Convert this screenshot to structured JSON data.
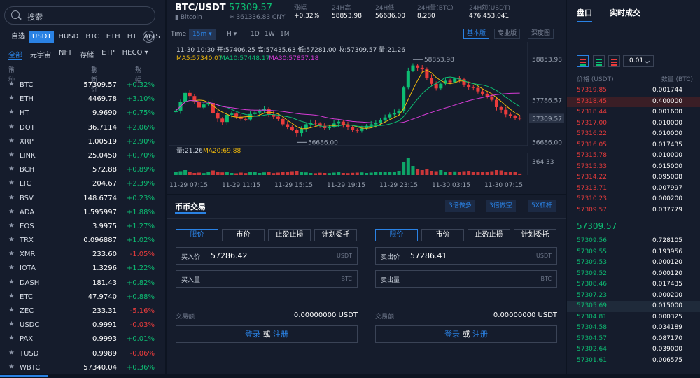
{
  "search": {
    "placeholder": "搜索"
  },
  "market_tabs": [
    "自选",
    "USDT",
    "HUSD",
    "BTC",
    "ETH",
    "HT",
    "ALTS"
  ],
  "market_tab_active": 1,
  "sub_tabs": [
    "全部",
    "元宇宙",
    "NFT",
    "存储",
    "ETP",
    "HECO"
  ],
  "sub_tab_dropdown_icon": "chevron-down-icon",
  "list_header": {
    "coin": "币种",
    "price": "最新价",
    "change": "涨幅"
  },
  "coins": [
    {
      "sym": "BTC",
      "price": "57309.57",
      "chg": "+0.32%",
      "dir": "up"
    },
    {
      "sym": "ETH",
      "price": "4469.78",
      "chg": "+3.10%",
      "dir": "up"
    },
    {
      "sym": "HT",
      "price": "9.9690",
      "chg": "+0.75%",
      "dir": "up"
    },
    {
      "sym": "DOT",
      "price": "36.7114",
      "chg": "+2.06%",
      "dir": "up"
    },
    {
      "sym": "XRP",
      "price": "1.00519",
      "chg": "+2.90%",
      "dir": "up"
    },
    {
      "sym": "LINK",
      "price": "25.0450",
      "chg": "+0.70%",
      "dir": "up"
    },
    {
      "sym": "BCH",
      "price": "572.88",
      "chg": "+0.89%",
      "dir": "up"
    },
    {
      "sym": "LTC",
      "price": "204.67",
      "chg": "+2.39%",
      "dir": "up"
    },
    {
      "sym": "BSV",
      "price": "148.6774",
      "chg": "+0.23%",
      "dir": "up"
    },
    {
      "sym": "ADA",
      "price": "1.595997",
      "chg": "+1.88%",
      "dir": "up"
    },
    {
      "sym": "EOS",
      "price": "3.9975",
      "chg": "+1.27%",
      "dir": "up"
    },
    {
      "sym": "TRX",
      "price": "0.096887",
      "chg": "+1.02%",
      "dir": "up"
    },
    {
      "sym": "XMR",
      "price": "233.60",
      "chg": "-1.05%",
      "dir": "down"
    },
    {
      "sym": "IOTA",
      "price": "1.3296",
      "chg": "+1.22%",
      "dir": "up"
    },
    {
      "sym": "DASH",
      "price": "181.43",
      "chg": "+0.82%",
      "dir": "up"
    },
    {
      "sym": "ETC",
      "price": "47.9740",
      "chg": "+0.88%",
      "dir": "up"
    },
    {
      "sym": "ZEC",
      "price": "233.31",
      "chg": "-5.16%",
      "dir": "down"
    },
    {
      "sym": "USDC",
      "price": "0.9991",
      "chg": "-0.03%",
      "dir": "down"
    },
    {
      "sym": "PAX",
      "price": "0.9993",
      "chg": "+0.01%",
      "dir": "up"
    },
    {
      "sym": "TUSD",
      "price": "0.9989",
      "chg": "-0.06%",
      "dir": "down"
    },
    {
      "sym": "WBTC",
      "price": "57340.04",
      "chg": "+0.36%",
      "dir": "up"
    }
  ],
  "header": {
    "pair": "BTC/USDT",
    "pair_sub": "Bitcoin",
    "last_price": "57309.57",
    "last_cny": "≈ 361336.83 CNY",
    "stats": [
      {
        "label": "涨幅",
        "value": "+0.32%"
      },
      {
        "label": "24H高",
        "value": "58853.98"
      },
      {
        "label": "24H低",
        "value": "56686.00"
      },
      {
        "label": "24H量(BTC)",
        "value": "8,280"
      },
      {
        "label": "24H额(USDT)",
        "value": "476,453,041"
      }
    ]
  },
  "chart_tools": {
    "time": "Time",
    "interval": "15m",
    "h": "H",
    "d1": "1D",
    "w1": "1W",
    "m1": "1M",
    "views": [
      "基本版",
      "专业版",
      "深度图"
    ]
  },
  "chart_data": {
    "type": "candlestick",
    "ohlc_info": "11-30 10:30  开:57406.25 高:57435.63 低:57281.00 收:57309.57 量:21.26",
    "ma_info": [
      {
        "label": "MA5:57340.07",
        "color": "#f0b90b"
      },
      {
        "label": "MA10:57448.17",
        "color": "#0dbd73"
      },
      {
        "label": "MA30:57857.18",
        "color": "#d63bd6"
      }
    ],
    "price_axis": [
      "58853.98",
      "57786.57",
      "57309.57",
      "56686.00"
    ],
    "high_marker": "58853.98",
    "low_marker": "56686.00",
    "volume_info": {
      "vol": "量:21.26",
      "ma20": "MA20:69.88"
    },
    "volume_axis": "364.33",
    "time_axis": [
      "11-29 07:15",
      "11-29 11:15",
      "11-29 15:15",
      "11-29 19:15",
      "11-29 23:15",
      "11-30 03:15",
      "11-30 07:15"
    ],
    "close": [
      57520,
      57740,
      57980,
      57900,
      57760,
      57600,
      57680,
      57720,
      57460,
      57310,
      57220,
      57410,
      57440,
      57360,
      57300,
      57290,
      57430,
      57470,
      57520,
      57560,
      57420,
      57360,
      57300,
      57160,
      57080,
      57020,
      56930,
      57040,
      57160,
      57200,
      57180,
      57120,
      57060,
      57100,
      57180,
      57230,
      57150,
      57080,
      57020,
      56990,
      57050,
      57120,
      57160,
      57200,
      57280,
      57340,
      57420,
      57460,
      57510,
      58120,
      58560,
      58700,
      58640,
      58600,
      58380,
      58220,
      58100,
      58220,
      58300,
      58260,
      58360,
      58340,
      58200,
      58140,
      58110,
      58020,
      57960,
      57880,
      57800,
      57610,
      57540,
      57420,
      57380,
      57330,
      57309.57
    ],
    "volume": [
      40,
      55,
      70,
      45,
      30,
      35,
      28,
      40,
      65,
      50,
      38,
      45,
      30,
      25,
      35,
      28,
      40,
      45,
      30,
      38,
      40,
      28,
      35,
      50,
      45,
      55,
      60,
      42,
      38,
      30,
      26,
      33,
      30,
      28,
      35,
      40,
      30,
      28,
      32,
      35,
      38,
      30,
      35,
      40,
      45,
      50,
      48,
      42,
      60,
      180,
      240,
      130,
      90,
      70,
      80,
      60,
      55,
      70,
      50,
      45,
      52,
      48,
      55,
      60,
      50,
      45,
      40,
      48,
      55,
      70,
      65,
      50,
      45,
      40,
      21
    ]
  },
  "trade": {
    "title": "币币交易",
    "leverage_buttons": [
      "3倍做多",
      "3倍做空",
      "5X杠杆"
    ],
    "order_types": [
      "限价",
      "市价",
      "止盈止损",
      "计划委托"
    ],
    "buy": {
      "price_label": "买入价",
      "price_value": "57286.42",
      "price_unit": "USDT",
      "amount_label": "买入量",
      "amount_unit": "BTC",
      "total_label": "交易额",
      "total_value": "0.00000000 USDT"
    },
    "sell": {
      "price_label": "卖出价",
      "price_value": "57286.41",
      "price_unit": "USDT",
      "amount_label": "卖出量",
      "amount_unit": "BTC",
      "total_label": "交易额",
      "total_value": "0.00000000 USDT"
    },
    "login": "登录",
    "or": "或",
    "register": "注册"
  },
  "orderbook": {
    "tabs": [
      "盘口",
      "实时成交"
    ],
    "precision": "0.01",
    "price_header": "价格 (USDT)",
    "qty_header": "数量 (BTC)",
    "asks": [
      {
        "p": "57319.85",
        "q": "0.001744"
      },
      {
        "p": "57318.45",
        "q": "0.400000"
      },
      {
        "p": "57318.44",
        "q": "0.001600"
      },
      {
        "p": "57317.00",
        "q": "0.010000"
      },
      {
        "p": "57316.22",
        "q": "0.010000"
      },
      {
        "p": "57316.05",
        "q": "0.017435"
      },
      {
        "p": "57315.78",
        "q": "0.010000"
      },
      {
        "p": "57315.33",
        "q": "0.015000"
      },
      {
        "p": "57314.22",
        "q": "0.095008"
      },
      {
        "p": "57313.71",
        "q": "0.007997"
      },
      {
        "p": "57310.23",
        "q": "0.000200"
      },
      {
        "p": "57309.57",
        "q": "0.037779"
      }
    ],
    "mid": "57309.57",
    "bids": [
      {
        "p": "57309.56",
        "q": "0.728105"
      },
      {
        "p": "57309.55",
        "q": "0.193956"
      },
      {
        "p": "57309.53",
        "q": "0.000120"
      },
      {
        "p": "57309.52",
        "q": "0.000120"
      },
      {
        "p": "57308.46",
        "q": "0.017435"
      },
      {
        "p": "57307.23",
        "q": "0.000200"
      },
      {
        "p": "57305.69",
        "q": "0.015000"
      },
      {
        "p": "57304.81",
        "q": "0.000325"
      },
      {
        "p": "57304.58",
        "q": "0.034189"
      },
      {
        "p": "57304.57",
        "q": "0.087170"
      },
      {
        "p": "57302.64",
        "q": "0.039000"
      },
      {
        "p": "57301.61",
        "q": "0.006575"
      }
    ]
  },
  "colors": {
    "up": "#0dbd73",
    "down": "#ea3c3c",
    "accent": "#2a82e4"
  }
}
